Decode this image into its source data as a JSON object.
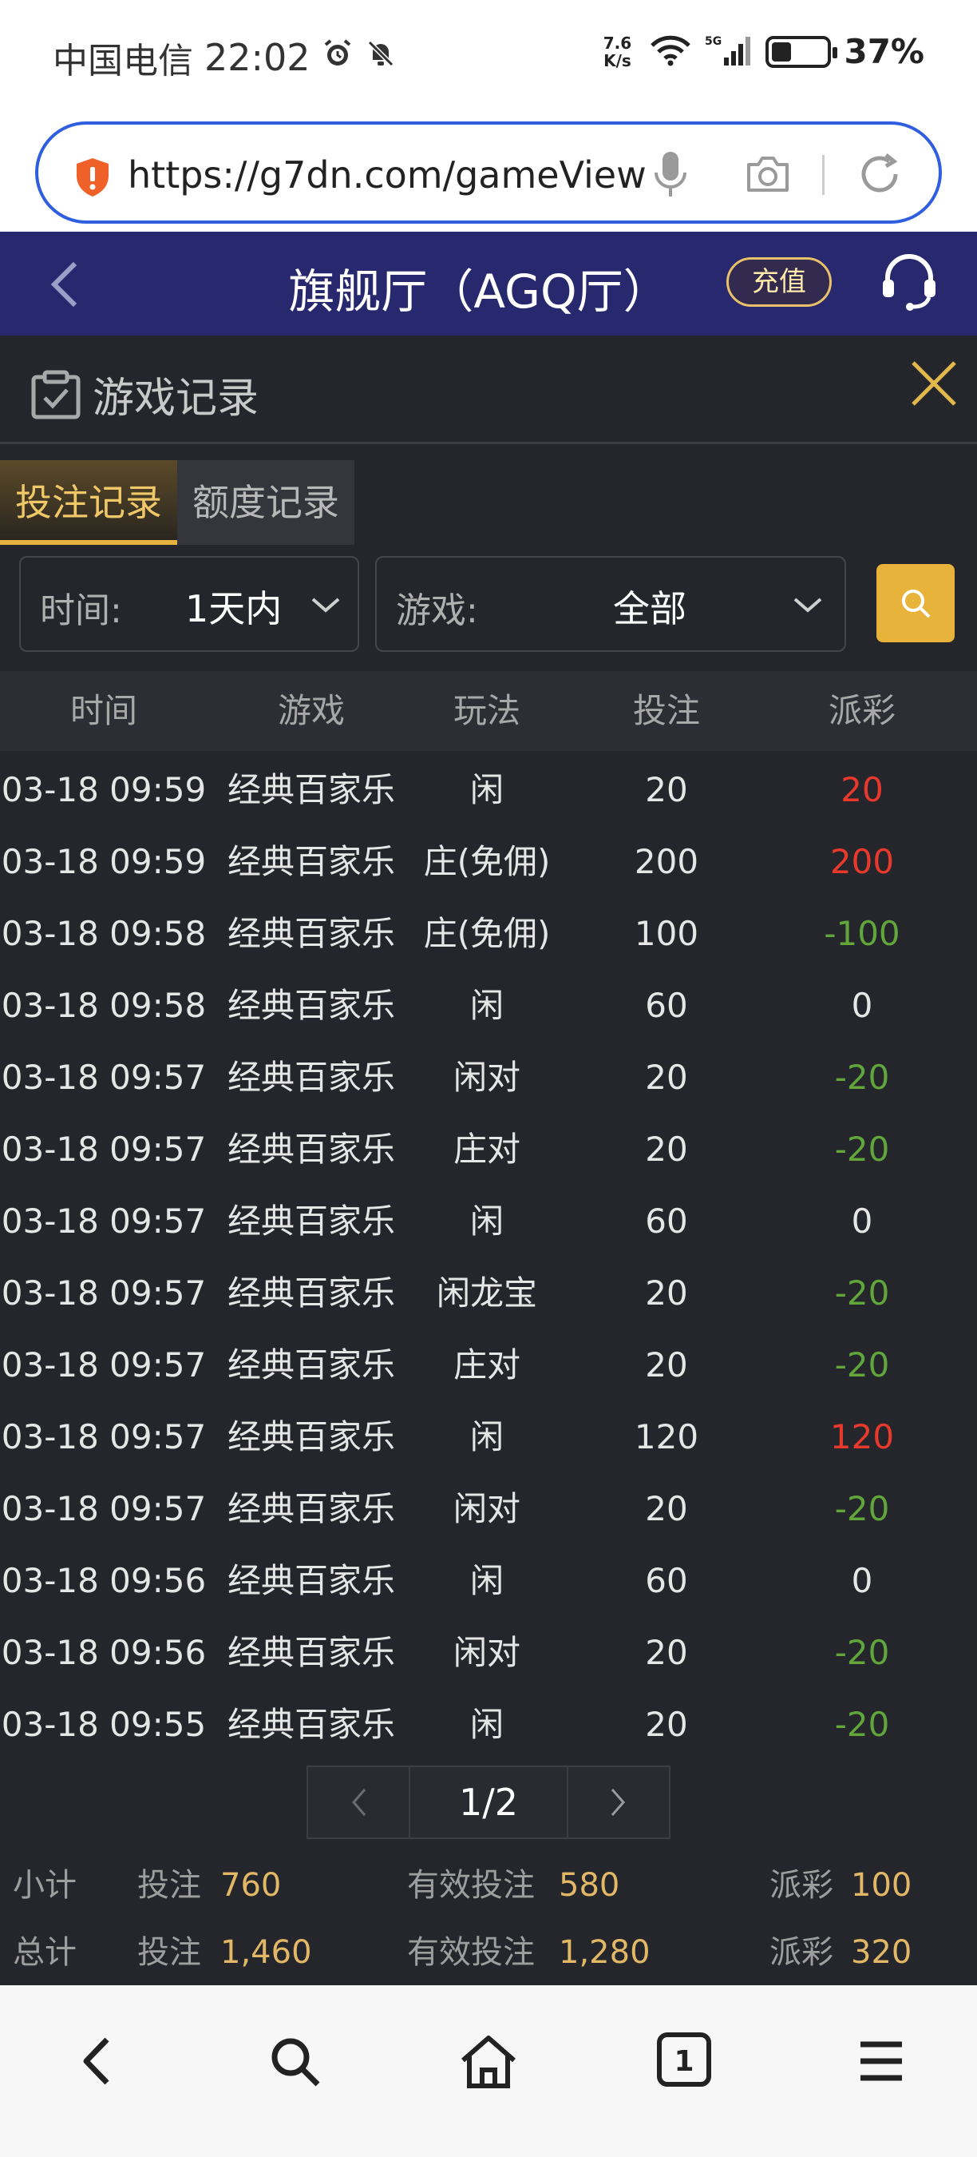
{
  "status_bar": {
    "carrier": "中国电信",
    "time": "22:02",
    "net_speed_value": "7.6",
    "net_speed_unit": "K/s",
    "battery_percent_text": "37%",
    "battery_level": 0.37
  },
  "browser": {
    "url": "https://g7dn.com/gameView"
  },
  "header": {
    "title": "旗舰厅（AGQ厅）",
    "recharge_label": "充值"
  },
  "panel": {
    "title": "游戏记录",
    "tabs": [
      {
        "label": "投注记录",
        "active": true
      },
      {
        "label": "额度记录",
        "active": false
      }
    ],
    "filters": {
      "time_label": "时间:",
      "time_value": "1天内",
      "game_label": "游戏:",
      "game_value": "全部"
    },
    "columns": [
      "时间",
      "游戏",
      "玩法",
      "投注",
      "派彩"
    ],
    "rows": [
      {
        "time": "03-18 09:59",
        "game": "经典百家乐",
        "play": "闲",
        "bet": "20",
        "payout": "20",
        "sign": "pos"
      },
      {
        "time": "03-18 09:59",
        "game": "经典百家乐",
        "play": "庄(免佣)",
        "bet": "200",
        "payout": "200",
        "sign": "pos"
      },
      {
        "time": "03-18 09:58",
        "game": "经典百家乐",
        "play": "庄(免佣)",
        "bet": "100",
        "payout": "-100",
        "sign": "neg"
      },
      {
        "time": "03-18 09:58",
        "game": "经典百家乐",
        "play": "闲",
        "bet": "60",
        "payout": "0",
        "sign": "zero"
      },
      {
        "time": "03-18 09:57",
        "game": "经典百家乐",
        "play": "闲对",
        "bet": "20",
        "payout": "-20",
        "sign": "neg"
      },
      {
        "time": "03-18 09:57",
        "game": "经典百家乐",
        "play": "庄对",
        "bet": "20",
        "payout": "-20",
        "sign": "neg"
      },
      {
        "time": "03-18 09:57",
        "game": "经典百家乐",
        "play": "闲",
        "bet": "60",
        "payout": "0",
        "sign": "zero"
      },
      {
        "time": "03-18 09:57",
        "game": "经典百家乐",
        "play": "闲龙宝",
        "bet": "20",
        "payout": "-20",
        "sign": "neg"
      },
      {
        "time": "03-18 09:57",
        "game": "经典百家乐",
        "play": "庄对",
        "bet": "20",
        "payout": "-20",
        "sign": "neg"
      },
      {
        "time": "03-18 09:57",
        "game": "经典百家乐",
        "play": "闲",
        "bet": "120",
        "payout": "120",
        "sign": "pos"
      },
      {
        "time": "03-18 09:57",
        "game": "经典百家乐",
        "play": "闲对",
        "bet": "20",
        "payout": "-20",
        "sign": "neg"
      },
      {
        "time": "03-18 09:56",
        "game": "经典百家乐",
        "play": "闲",
        "bet": "60",
        "payout": "0",
        "sign": "zero"
      },
      {
        "time": "03-18 09:56",
        "game": "经典百家乐",
        "play": "闲对",
        "bet": "20",
        "payout": "-20",
        "sign": "neg"
      },
      {
        "time": "03-18 09:55",
        "game": "经典百家乐",
        "play": "闲",
        "bet": "20",
        "payout": "-20",
        "sign": "neg"
      }
    ],
    "pagination": {
      "page_text": "1/2"
    },
    "summary": {
      "subtotal": {
        "label": "小计",
        "bet_label": "投注",
        "bet": "760",
        "valid_label": "有效投注",
        "valid": "580",
        "payout_label": "派彩",
        "payout": "100"
      },
      "total": {
        "label": "总计",
        "bet_label": "投注",
        "bet": "1,460",
        "valid_label": "有效投注",
        "valid": "1,280",
        "payout_label": "派彩",
        "payout": "320"
      }
    }
  },
  "bottom_nav": {
    "tabs_count": "1",
    "icons": [
      "back-icon",
      "search-icon",
      "home-icon",
      "tabs-icon",
      "menu-icon"
    ]
  },
  "colors": {
    "header_bg": "#28286e",
    "panel_bg": "#25262b",
    "accent_gold": "#e8b33a",
    "positive_red": "#e8392c",
    "negative_green": "#61a63a",
    "url_border": "#2f5fe0"
  }
}
